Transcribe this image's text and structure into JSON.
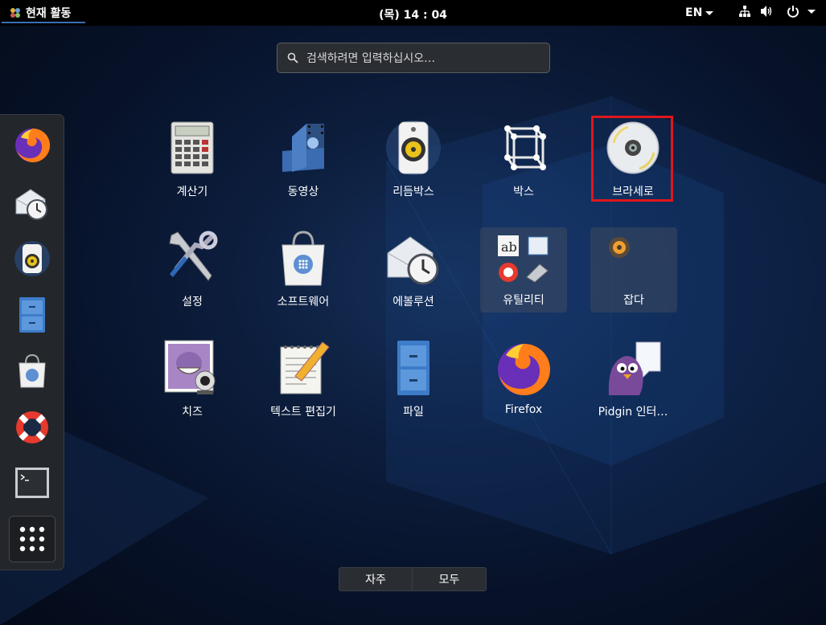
{
  "topbar": {
    "activities": "현재 활동",
    "clock": "(목) 14 : 04",
    "language": "EN",
    "network_icon": "network-icon",
    "volume_icon": "volume-icon",
    "power_icon": "power-icon"
  },
  "search": {
    "placeholder": "검색하려면 입력하십시오…"
  },
  "dash": {
    "items": [
      "firefox-icon",
      "evolution-icon",
      "rhythmbox-icon",
      "files-icon",
      "software-icon",
      "help-icon",
      "terminal-icon",
      "show-apps-icon"
    ]
  },
  "apps": [
    {
      "label": "계산기",
      "icon": "calculator-icon"
    },
    {
      "label": "동영상",
      "icon": "videos-icon"
    },
    {
      "label": "리듬박스",
      "icon": "rhythmbox-icon"
    },
    {
      "label": "박스",
      "icon": "boxes-icon"
    },
    {
      "label": "브라세로",
      "icon": "brasero-icon"
    },
    {
      "label": "설정",
      "icon": "settings-icon"
    },
    {
      "label": "소프트웨어",
      "icon": "software-icon"
    },
    {
      "label": "에볼루션",
      "icon": "evolution-icon"
    },
    {
      "label": "유틸리티",
      "icon": "utilities-folder-icon"
    },
    {
      "label": "잡다",
      "icon": "sundry-folder-icon"
    },
    {
      "label": "치즈",
      "icon": "cheese-icon"
    },
    {
      "label": "텍스트 편집기",
      "icon": "text-editor-icon"
    },
    {
      "label": "파일",
      "icon": "files-icon"
    },
    {
      "label": "Firefox",
      "icon": "firefox-icon"
    },
    {
      "label": "Pidgin 인터…",
      "icon": "pidgin-icon"
    }
  ],
  "bottom_toggle": {
    "frequent": "자주",
    "all": "모두"
  }
}
